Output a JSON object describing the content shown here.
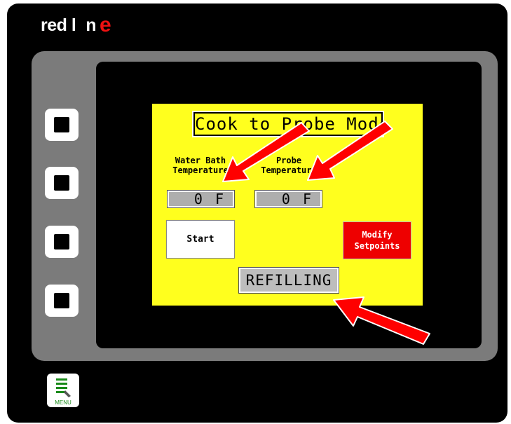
{
  "brand": {
    "logo_text": "red lion"
  },
  "screen": {
    "title": "Cook to Probe Mode",
    "water_bath": {
      "label_line1": "Water Bath",
      "label_line2": "Temperature",
      "value": "0 F"
    },
    "probe": {
      "label_line1": "Probe",
      "label_line2": "Temperature",
      "value": "0 F"
    },
    "start_button": "Start",
    "modify_button_line1": "Modify",
    "modify_button_line2": "Setpoints",
    "status": "REFILLING"
  },
  "keys": {
    "menu_label": "MENU",
    "side_key_count": 4
  },
  "colors": {
    "lcd_background": "#ffff1e",
    "modify_button": "#ee0000",
    "annotation_arrow": "#ff0000",
    "bezel": "#7b7b7b"
  },
  "icons": {
    "menu_icon": "menu-list-icon"
  }
}
